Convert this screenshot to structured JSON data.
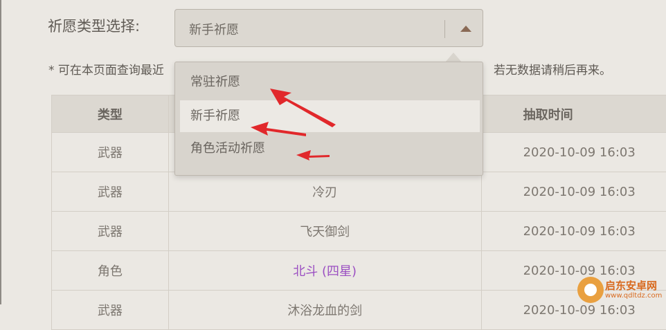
{
  "filter": {
    "label": "祈愿类型选择:",
    "selected_value": "新手祈愿"
  },
  "note": {
    "left_text": "* 可在本页面查询最近",
    "right_text": "若无数据请稍后再来。"
  },
  "dropdown": {
    "options": [
      "常驻祈愿",
      "新手祈愿",
      "角色活动祈愿"
    ],
    "selected_index": 1
  },
  "table": {
    "headers": [
      "类型",
      "",
      "抽取时间"
    ],
    "rows": [
      {
        "type": "武器",
        "name": "",
        "time": "2020-10-09 16:03"
      },
      {
        "type": "武器",
        "name": "冷刃",
        "time": "2020-10-09 16:03"
      },
      {
        "type": "武器",
        "name": "飞天御剑",
        "time": "2020-10-09 16:03"
      },
      {
        "type": "角色",
        "name": "北斗 (四星)",
        "time": "2020-10-09 16:03"
      },
      {
        "type": "武器",
        "name": "沐浴龙血的剑",
        "time": "2020-10-09 16:03"
      }
    ]
  },
  "colors": {
    "four_star": "#9b4fc2",
    "annotation_arrow": "#e1282b"
  },
  "watermark": {
    "title": "启东安卓网",
    "url": "www.qdltdz.com"
  }
}
